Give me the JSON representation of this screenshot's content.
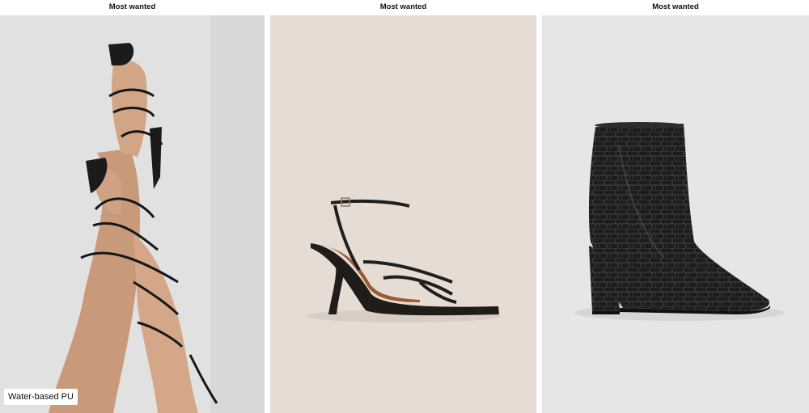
{
  "products": [
    {
      "badge": "Most wanted",
      "image": "lace-up-square-toe-heeled-sandal-photo",
      "material_tag": "Water-based PU"
    },
    {
      "badge": "Most wanted",
      "image": "strappy-square-toe-sandal-photo"
    },
    {
      "badge": "Most wanted",
      "image": "black-croc-ankle-boot-photo"
    }
  ],
  "colors": {
    "badge_bg": "#ffffff",
    "card1_bg": "#e2e2e2",
    "card2_bg": "#e7ddd4",
    "card3_bg": "#e6e6e8"
  }
}
